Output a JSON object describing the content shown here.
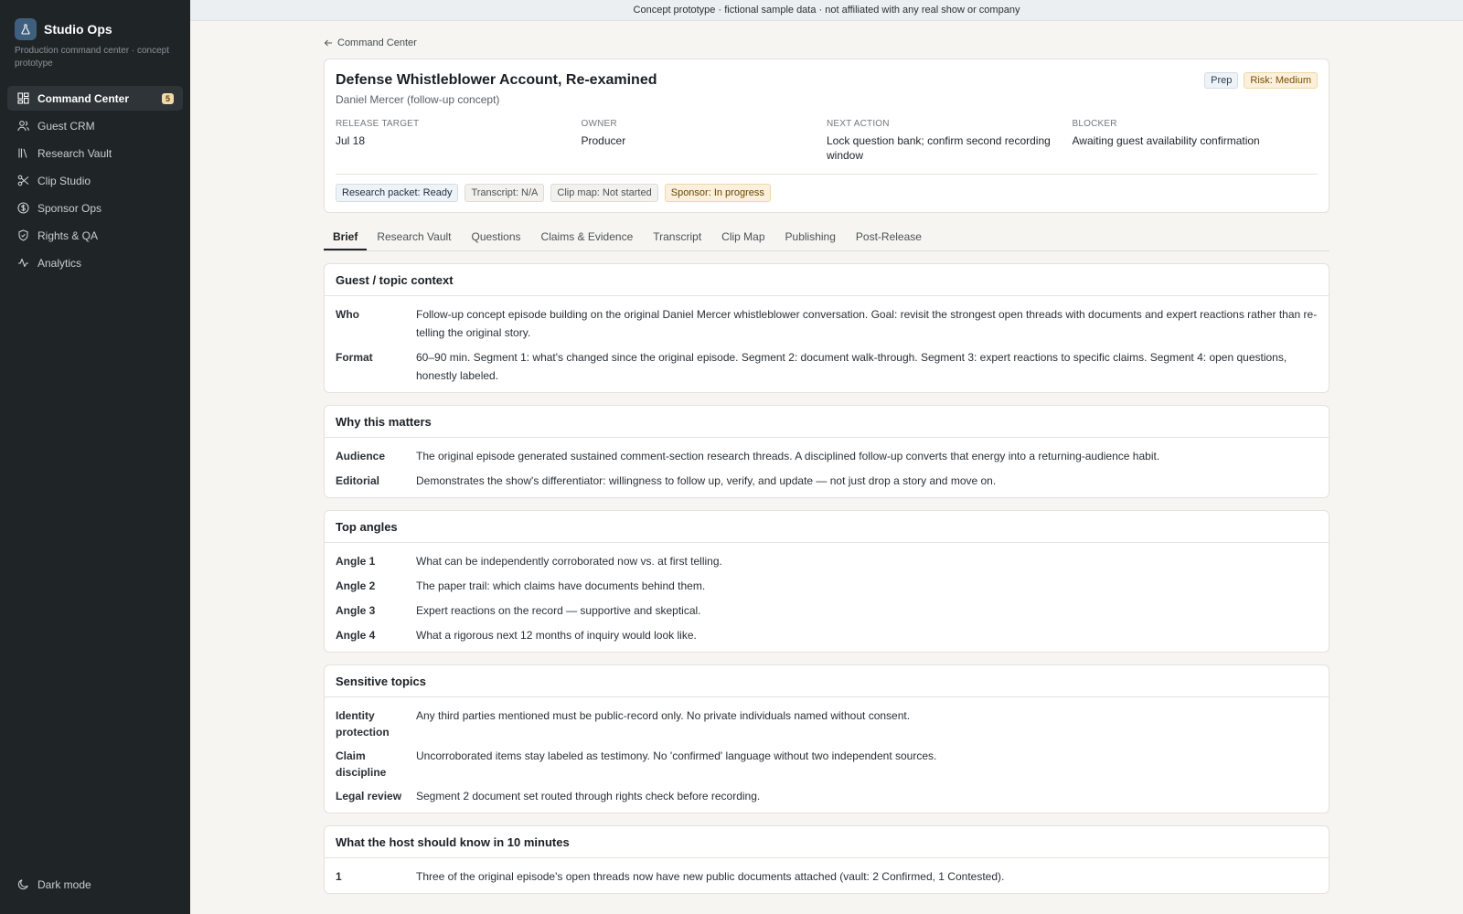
{
  "app": {
    "name": "Studio Ops",
    "subtitle": "Production command center · concept prototype"
  },
  "banner": "Concept prototype · fictional sample data · not affiliated with any real show or company",
  "sidebar": {
    "items": [
      {
        "label": "Command Center",
        "icon": "grid-icon",
        "badge": "5",
        "active": true
      },
      {
        "label": "Guest CRM",
        "icon": "users-icon"
      },
      {
        "label": "Research Vault",
        "icon": "library-icon"
      },
      {
        "label": "Clip Studio",
        "icon": "scissors-icon"
      },
      {
        "label": "Sponsor Ops",
        "icon": "dollar-icon"
      },
      {
        "label": "Rights & QA",
        "icon": "shield-icon"
      },
      {
        "label": "Analytics",
        "icon": "activity-icon"
      }
    ],
    "dark_mode_label": "Dark mode"
  },
  "back_label": "Command Center",
  "episode": {
    "title": "Defense Whistleblower Account, Re-examined",
    "subtitle": "Daniel Mercer (follow-up concept)",
    "tags": {
      "stage": "Prep",
      "risk": "Risk: Medium"
    },
    "meta": {
      "release_label": "RELEASE TARGET",
      "release_value": "Jul 18",
      "owner_label": "OWNER",
      "owner_value": "Producer",
      "next_label": "NEXT ACTION",
      "next_value": "Lock question bank; confirm second recording window",
      "blocker_label": "BLOCKER",
      "blocker_value": "Awaiting guest availability confirmation"
    },
    "status_chips": {
      "research": "Research packet: Ready",
      "transcript": "Transcript: N/A",
      "clipmap": "Clip map: Not started",
      "sponsor": "Sponsor: In progress"
    }
  },
  "tabs": [
    "Brief",
    "Research Vault",
    "Questions",
    "Claims & Evidence",
    "Transcript",
    "Clip Map",
    "Publishing",
    "Post-Release"
  ],
  "sections": {
    "context": {
      "title": "Guest / topic context",
      "rows": [
        {
          "label": "Who",
          "value": "Follow-up concept episode building on the original Daniel Mercer whistleblower conversation. Goal: revisit the strongest open threads with documents and expert reactions rather than re-telling the original story."
        },
        {
          "label": "Format",
          "value": "60–90 min. Segment 1: what's changed since the original episode. Segment 2: document walk-through. Segment 3: expert reactions to specific claims. Segment 4: open questions, honestly labeled."
        }
      ]
    },
    "why": {
      "title": "Why this matters",
      "rows": [
        {
          "label": "Audience",
          "value": "The original episode generated sustained comment-section research threads. A disciplined follow-up converts that energy into a returning-audience habit."
        },
        {
          "label": "Editorial",
          "value": "Demonstrates the show's differentiator: willingness to follow up, verify, and update — not just drop a story and move on."
        }
      ]
    },
    "angles": {
      "title": "Top angles",
      "rows": [
        {
          "label": "Angle 1",
          "value": "What can be independently corroborated now vs. at first telling."
        },
        {
          "label": "Angle 2",
          "value": "The paper trail: which claims have documents behind them."
        },
        {
          "label": "Angle 3",
          "value": "Expert reactions on the record — supportive and skeptical."
        },
        {
          "label": "Angle 4",
          "value": "What a rigorous next 12 months of inquiry would look like."
        }
      ]
    },
    "sensitive": {
      "title": "Sensitive topics",
      "rows": [
        {
          "label": "Identity protection",
          "value": "Any third parties mentioned must be public-record only. No private individuals named without consent."
        },
        {
          "label": "Claim discipline",
          "value": "Uncorroborated items stay labeled as testimony. No 'confirmed' language without two independent sources."
        },
        {
          "label": "Legal review",
          "value": "Segment 2 document set routed through rights check before recording."
        }
      ]
    },
    "host": {
      "title": "What the host should know in 10 minutes",
      "rows": [
        {
          "label": "1",
          "value": "Three of the original episode's open threads now have new public documents attached (vault: 2 Confirmed, 1 Contested)."
        }
      ]
    }
  },
  "colors": {
    "sidebar_bg": "#1f2427",
    "accent_badge": "#f3d9a8",
    "risk_tag": "#fbf0dc"
  }
}
